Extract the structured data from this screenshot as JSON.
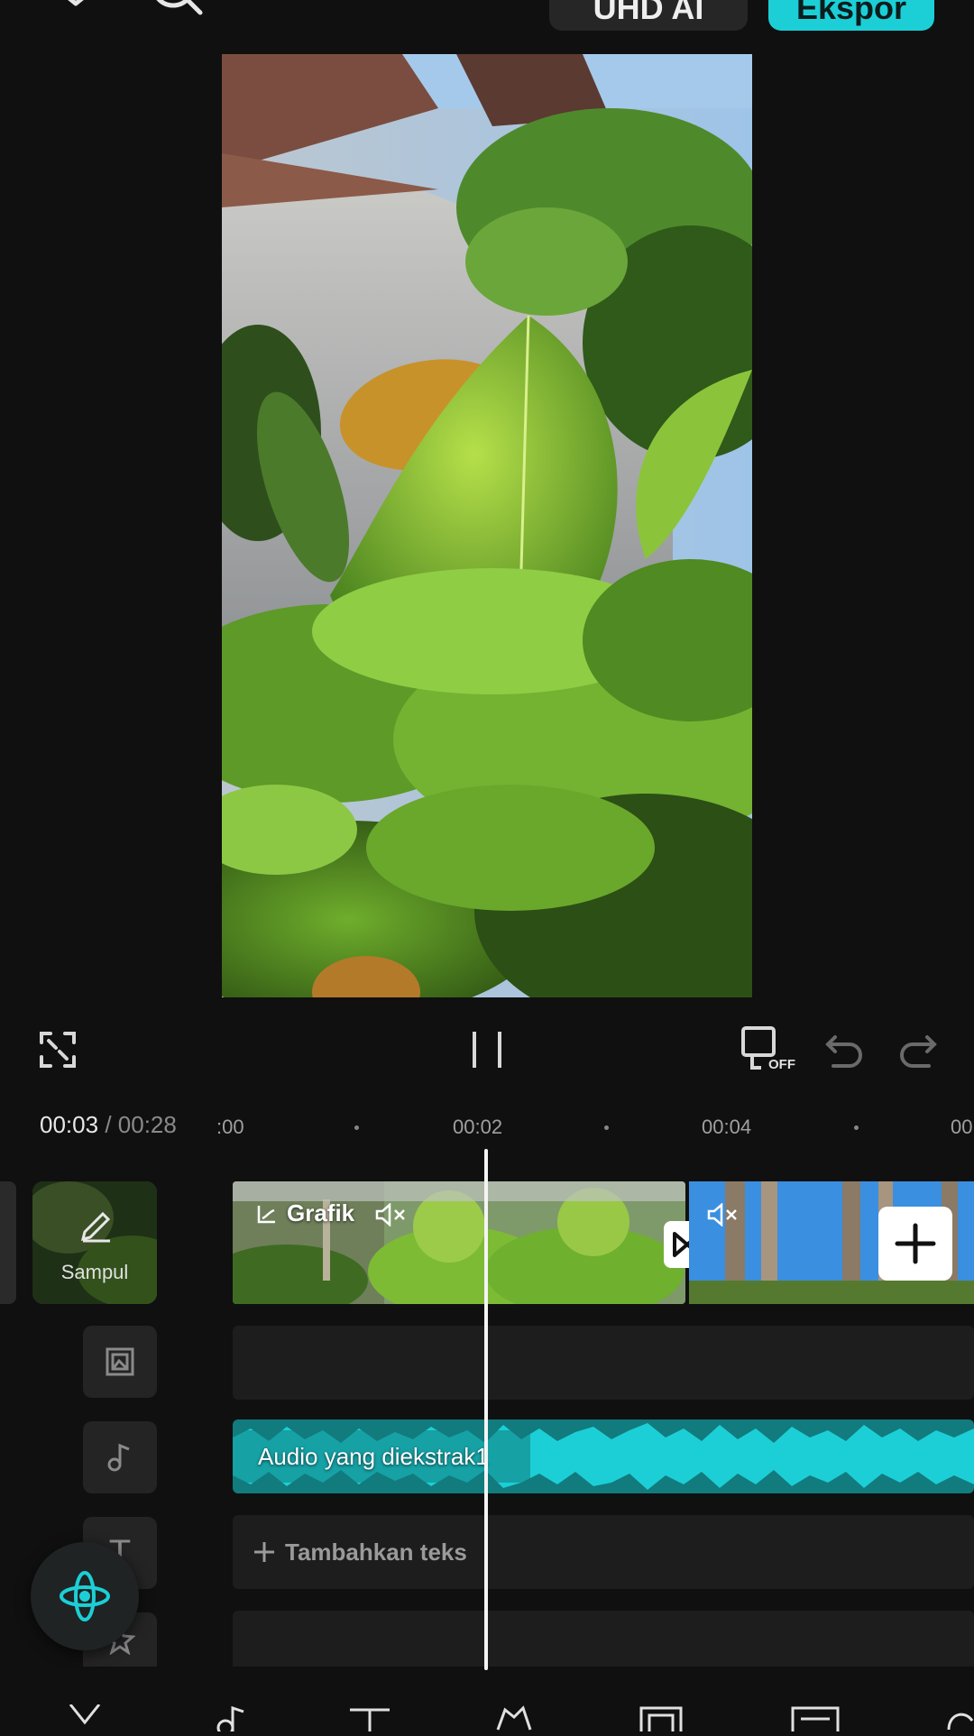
{
  "topbar": {
    "close_icon": "close-icon",
    "search_icon": "search-icon",
    "resolution_label": "UHD AI",
    "export_label": "Ekspor",
    "accent": "#1ccfd6"
  },
  "preview": {
    "description_icon": "video-frame"
  },
  "controls": {
    "fullscreen_icon": "fullscreen-icon",
    "pause_icon": "pause-icon",
    "keyframe_off_badge": "OFF",
    "undo_icon": "undo-icon",
    "redo_icon": "redo-icon"
  },
  "time": {
    "current": "00:03",
    "separator": "/",
    "total": "00:28",
    "ruler": [
      ":00",
      "00:02",
      "00:04",
      "00"
    ]
  },
  "timeline": {
    "cover_label": "Sampul",
    "clip_label": "Grafik",
    "add_clip_icon": "plus-icon",
    "transition_icon": "transition-icon",
    "audio_label": "Audio yang diekstrak1",
    "add_text_label": "Tambahkan teks",
    "audio_color": "#1ccfd6"
  }
}
